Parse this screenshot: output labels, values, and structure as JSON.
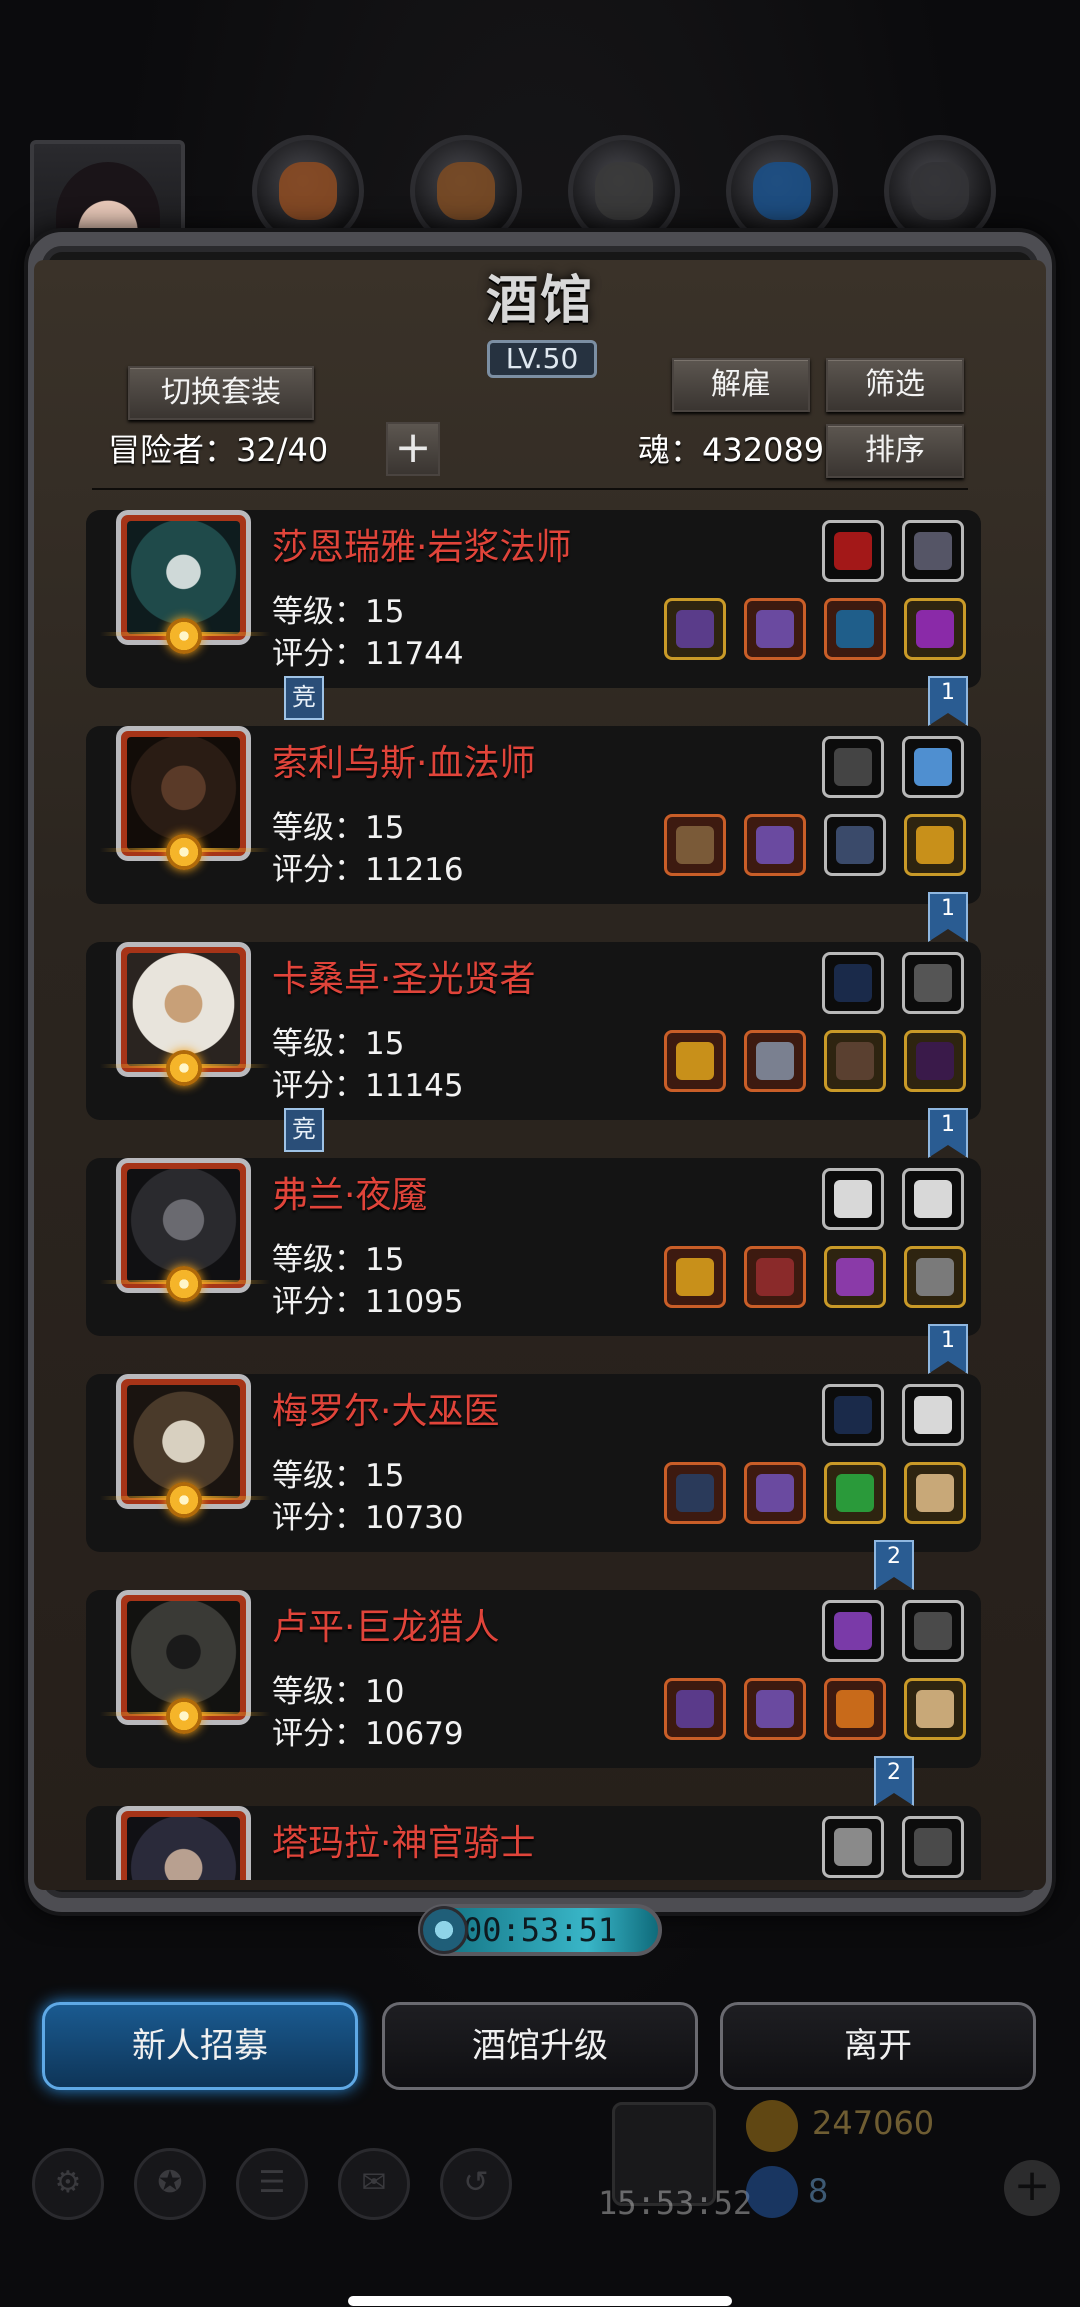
{
  "tavern": {
    "title": "酒馆",
    "level": "LV.50",
    "switch_outfit_label": "切换套装",
    "dismiss_label": "解雇",
    "filter_label": "筛选",
    "sort_label": "排序",
    "adventurers_label": "冒险者：32/40",
    "soul_label": "魂：432089",
    "plus_label": "+"
  },
  "heroes": [
    {
      "name": "莎恩瑞雅·岩浆法师",
      "level": "等级：15",
      "score": "评分：11744",
      "tag": "竞",
      "rank": "1"
    },
    {
      "name": "索利乌斯·血法师",
      "level": "等级：15",
      "score": "评分：11216",
      "tag": "",
      "rank": "1"
    },
    {
      "name": "卡桑卓·圣光贤者",
      "level": "等级：15",
      "score": "评分：11145",
      "tag": "竞",
      "rank": "1"
    },
    {
      "name": "弗兰·夜魇",
      "level": "等级：15",
      "score": "评分：11095",
      "tag": "",
      "rank": "1"
    },
    {
      "name": "梅罗尔·大巫医",
      "level": "等级：15",
      "score": "评分：10730",
      "tag": "",
      "rank": "2"
    },
    {
      "name": "卢平·巨龙猎人",
      "level": "等级：10",
      "score": "评分：10679",
      "tag": "",
      "rank": "2"
    },
    {
      "name": "塔玛拉·神官骑士",
      "level": "",
      "score": "",
      "tag": "",
      "rank": ""
    }
  ],
  "timer": "00:53:51",
  "actions": {
    "recruit": "新人招募",
    "upgrade": "酒馆升级",
    "leave": "离开"
  },
  "background": {
    "gold": "247060",
    "gem": "8",
    "gift_timer": "15:53:52"
  },
  "colors": {
    "hero_name": "#e0443a",
    "primary_button": "#1a5a90",
    "rank_ribbon": "#2a5c92",
    "panel_bg": "#2b251f"
  }
}
